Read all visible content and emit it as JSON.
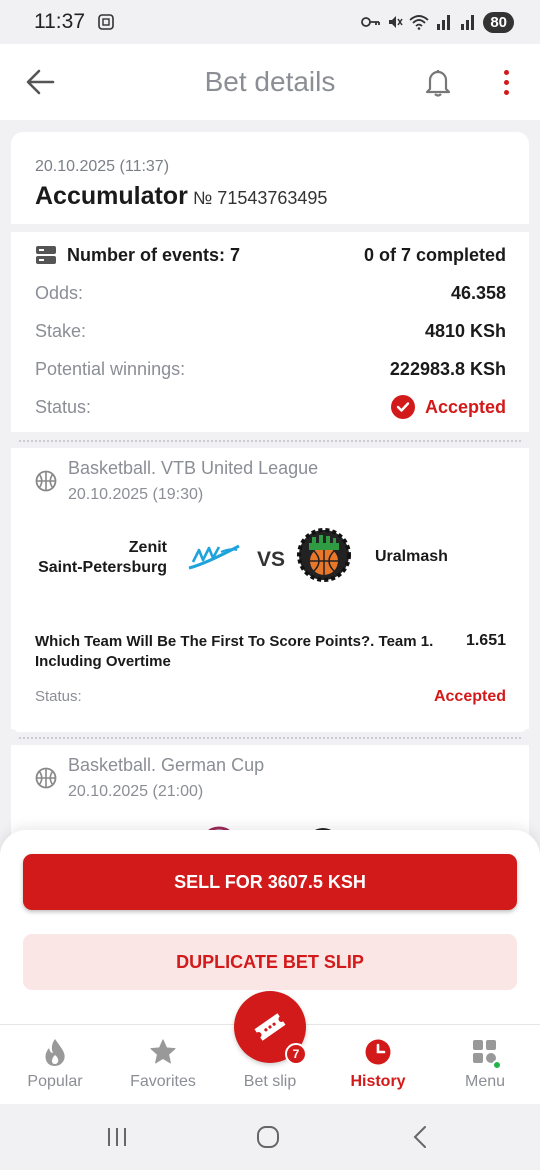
{
  "status_bar": {
    "time": "11:37",
    "battery": "80"
  },
  "header": {
    "title": "Bet details"
  },
  "bet": {
    "date": "20.10.2025 (11:37)",
    "type": "Accumulator",
    "number": "№ 71543763495",
    "events_label": "Number of events: 7",
    "events_completed": "0 of 7 completed",
    "odds_label": "Odds:",
    "odds_value": "46.358",
    "stake_label": "Stake:",
    "stake_value": "4810 KSh",
    "winnings_label": "Potential winnings:",
    "winnings_value": "222983.8 KSh",
    "status_label": "Status:",
    "status_value": "Accepted"
  },
  "events": [
    {
      "league": "Basketball. VTB United League",
      "date": "20.10.2025 (19:30)",
      "home_line1": "Zenit",
      "home_line2": "Saint-Petersburg",
      "away": "Uralmash",
      "vs": "VS",
      "market": "Which Team Will Be The First To Score Points?. Team 1. Including Overtime",
      "odds": "1.651",
      "status_label": "Status:",
      "status_value": "Accepted"
    },
    {
      "league": "Basketball. German Cup",
      "date": "20.10.2025 (21:00)"
    }
  ],
  "actions": {
    "sell": "SELL FOR 3607.5 KSH",
    "duplicate": "DUPLICATE BET SLIP"
  },
  "tabs": [
    {
      "label": "Popular",
      "icon": "flame-icon"
    },
    {
      "label": "Favorites",
      "icon": "star-icon"
    },
    {
      "label": "Bet slip",
      "icon": "ticket-icon",
      "badge": "7"
    },
    {
      "label": "History",
      "icon": "clock-icon",
      "active": true
    },
    {
      "label": "Menu",
      "icon": "grid-icon"
    }
  ],
  "colors": {
    "accent": "#d31a1a",
    "muted": "#8b8e94",
    "background": "#f1f1f3",
    "online": "#22b34b"
  }
}
